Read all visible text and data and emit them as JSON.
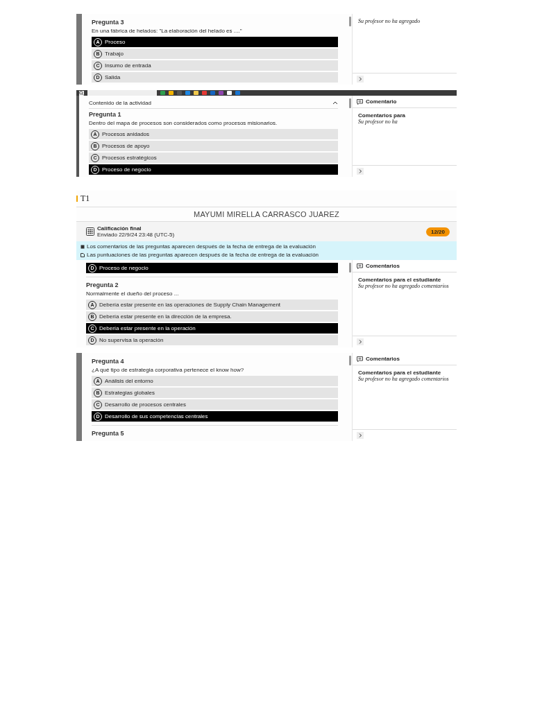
{
  "screenshots": [
    {
      "left_bar": true,
      "taskbar": false,
      "questions": [
        {
          "title": "Pregunta 3",
          "text": "En una fábrica de helados: \"La elaboración del helado es ....\"",
          "options": [
            {
              "letter": "A",
              "text": "Proceso",
              "selected": true
            },
            {
              "letter": "B",
              "text": "Trabajo",
              "selected": false
            },
            {
              "letter": "C",
              "text": "Insumo de entrada",
              "selected": false
            },
            {
              "letter": "D",
              "text": "Salida",
              "selected": false
            }
          ]
        }
      ],
      "sidebar": {
        "note": "Su profesor no ha agregado"
      }
    },
    {
      "left_bar": true,
      "taskbar": true,
      "section_header": "Contenido de la actividad",
      "questions": [
        {
          "title": "Pregunta 1",
          "text": "Dentro del mapa de procesos son considerados como procesos misionarios.",
          "options": [
            {
              "letter": "A",
              "text": "Procesos anidados",
              "selected": false
            },
            {
              "letter": "B",
              "text": "Procesos de apoyo",
              "selected": false
            },
            {
              "letter": "C",
              "text": "Procesos estratégicos",
              "selected": false
            },
            {
              "letter": "D",
              "text": "Proceso de negocio",
              "selected": true
            }
          ]
        }
      ],
      "sidebar": {
        "title": "Comentario",
        "heading": "Comentarios para",
        "note": "Su profesor no ha"
      }
    },
    {
      "left_bar": false,
      "taskbar": false,
      "page_title": "T1",
      "student_name": "MAYUMI MIRELLA CARRASCO JUAREZ",
      "grade": {
        "label": "Calificación final",
        "submitted": "Enviado 22/9/24 23:48 (UTC-5)",
        "score": "12/20"
      },
      "notices": [
        "Los comentarios de las preguntas aparecen después de la fecha de entrega de la evaluación",
        "Las puntuaciones de las preguntas aparecen después de la fecha de entrega de la evaluación"
      ],
      "questions": [
        {
          "options": [
            {
              "letter": "D",
              "text": "Proceso de negocio",
              "selected": true
            }
          ]
        },
        {
          "title": "Pregunta 2",
          "text": "Normalmente el dueño del proceso ...",
          "options": [
            {
              "letter": "A",
              "text": "Debería estar presente en las operaciones de Supply Chain Management",
              "selected": false
            },
            {
              "letter": "B",
              "text": "Debería estar presente en la dirección de la empresa.",
              "selected": false
            },
            {
              "letter": "C",
              "text": "Debería estar presente en la operación",
              "selected": true
            },
            {
              "letter": "D",
              "text": "No supervisa la operación",
              "selected": false
            }
          ]
        }
      ],
      "sidebar": {
        "title": "Comentarios",
        "heading": "Comentarios para el estudiante",
        "note": "Su profesor no ha agregado comentarios"
      }
    },
    {
      "left_bar": true,
      "taskbar": false,
      "questions": [
        {
          "title": "Pregunta 4",
          "text": "¿A qué tipo de estrategia corporativa pertenece el know how?",
          "options": [
            {
              "letter": "A",
              "text": "Análisis del entorno",
              "selected": false
            },
            {
              "letter": "B",
              "text": "Estrategias globales",
              "selected": false
            },
            {
              "letter": "C",
              "text": "Desarrollo de procesos centrales",
              "selected": false
            },
            {
              "letter": "D",
              "text": "Desarrollo de sus competencias centrales",
              "selected": true
            }
          ]
        },
        {
          "title": "Pregunta 5"
        }
      ],
      "sidebar": {
        "title": "Comentarios",
        "heading": "Comentarios para el estudiante",
        "note": "Su profesor no ha agregado comentarios"
      }
    }
  ]
}
